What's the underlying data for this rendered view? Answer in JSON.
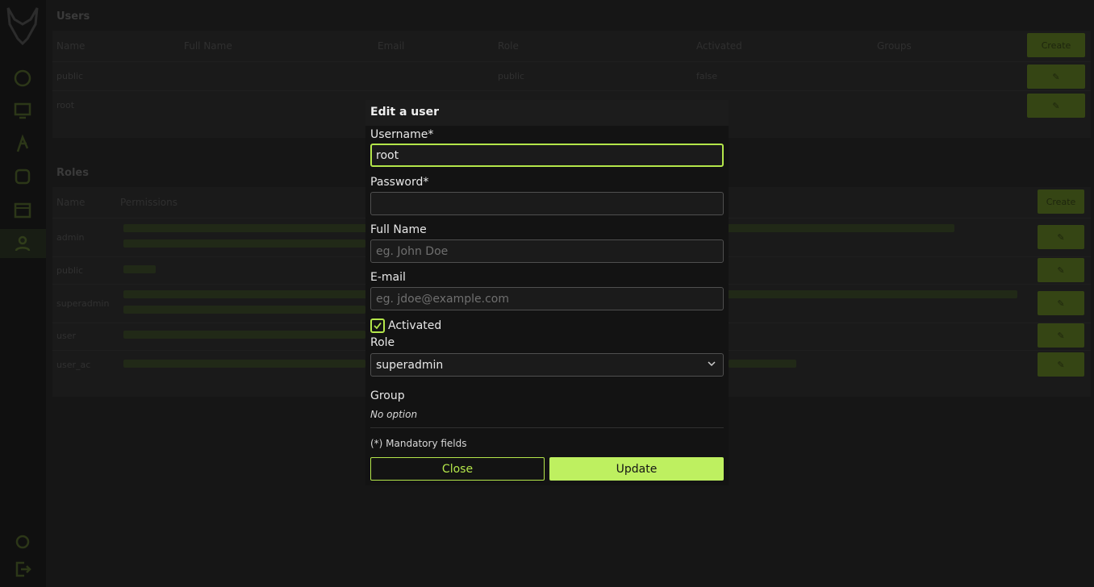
{
  "colors": {
    "accent": "#b4e64a",
    "accent_fill": "#bef060",
    "modal_bg": "#131313",
    "page_bg": "#1f1f1f"
  },
  "background": {
    "users": {
      "title": "Users",
      "columns": [
        "Name",
        "Full Name",
        "Email",
        "Role",
        "Activated",
        "Groups"
      ],
      "create_label": "Create",
      "rows": [
        {
          "name": "public",
          "role": "public",
          "activated": "false"
        },
        {
          "name": "root"
        }
      ]
    },
    "roles": {
      "title": "Roles",
      "columns": [
        "Name",
        "Permissions"
      ],
      "create_label": "Create",
      "rows": [
        {
          "name": "admin"
        },
        {
          "name": "public"
        },
        {
          "name": "superadmin"
        },
        {
          "name": "user"
        },
        {
          "name": "user_ac"
        }
      ]
    },
    "icons": [
      "logo-icon",
      "dashboard-icon",
      "monitor-icon",
      "function-icon",
      "pipeline-icon",
      "calendar-icon",
      "users-icon",
      "settings-icon",
      "logout-icon"
    ]
  },
  "modal": {
    "title": "Edit a user",
    "username_label": "Username*",
    "username_value": "root",
    "password_label": "Password*",
    "password_value": "",
    "fullname_label": "Full Name",
    "fullname_placeholder": "eg. John Doe",
    "email_label": "E-mail",
    "email_placeholder": "eg. jdoe@example.com",
    "activated_label": "Activated",
    "activated_checked": true,
    "role_label": "Role",
    "role_value": "superadmin",
    "group_label": "Group",
    "group_empty": "No option",
    "mandatory_note": "(*) Mandatory fields",
    "close_label": "Close",
    "update_label": "Update"
  }
}
